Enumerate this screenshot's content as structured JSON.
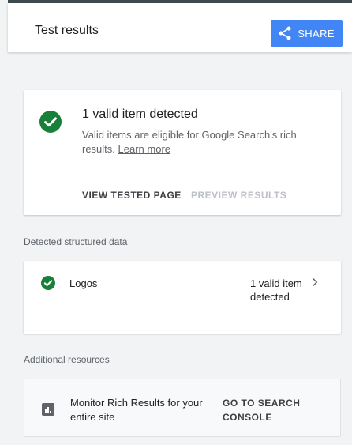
{
  "header": {
    "title": "Test results",
    "share_label": "SHARE",
    "accent": "#4285f4"
  },
  "result_card": {
    "title": "1 valid item detected",
    "description": "Valid items are eligible for Google Search's rich results.",
    "learn_more": "Learn more",
    "view_tested_page": "VIEW TESTED PAGE",
    "preview_results": "PREVIEW RESULTS",
    "status_color": "#188038"
  },
  "structured_data": {
    "section_label": "Detected structured data",
    "items": [
      {
        "label": "Logos",
        "status": "1 valid item detected"
      }
    ]
  },
  "resources": {
    "section_label": "Additional resources",
    "item_text": "Monitor Rich Results for your entire site",
    "action_label": "GO TO SEARCH CONSOLE"
  },
  "icons": {
    "share": "share-icon",
    "check": "check-circle-icon",
    "chevron": "chevron-right-icon",
    "chart": "bar-chart-icon"
  }
}
